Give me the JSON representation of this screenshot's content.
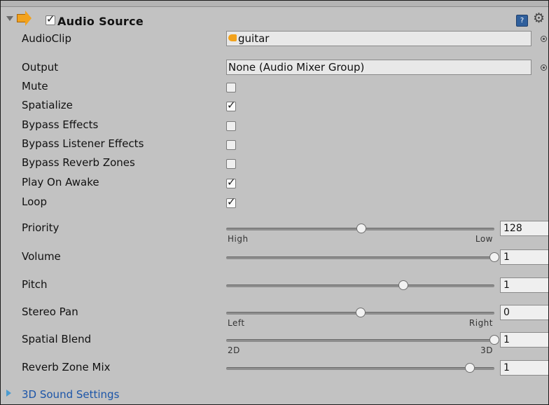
{
  "component": {
    "title": "Audio Source",
    "enabled": true,
    "help_icon": "help-book-icon",
    "settings_icon": "gear-icon"
  },
  "audio_clip": {
    "label": "AudioClip",
    "value": "guitar"
  },
  "output": {
    "label": "Output",
    "value": "None (Audio Mixer Group)"
  },
  "toggles": [
    {
      "label": "Mute",
      "checked": false
    },
    {
      "label": "Spatialize",
      "checked": true
    },
    {
      "label": "Bypass Effects",
      "checked": false
    },
    {
      "label": "Bypass Listener Effects",
      "checked": false
    },
    {
      "label": "Bypass Reverb Zones",
      "checked": false
    },
    {
      "label": "Play On Awake",
      "checked": true
    },
    {
      "label": "Loop",
      "checked": true
    }
  ],
  "sliders": [
    {
      "label": "Priority",
      "value": "128",
      "min_label": "High",
      "max_label": "Low",
      "fraction": 0.503
    },
    {
      "label": "Volume",
      "value": "1",
      "min_label": "",
      "max_label": "",
      "fraction": 1.0
    },
    {
      "label": "Pitch",
      "value": "1",
      "min_label": "",
      "max_label": "",
      "fraction": 0.661
    },
    {
      "label": "Stereo Pan",
      "value": "0",
      "min_label": "Left",
      "max_label": "Right",
      "fraction": 0.5
    },
    {
      "label": "Spatial Blend",
      "value": "1",
      "min_label": "2D",
      "max_label": "3D",
      "fraction": 1.0
    },
    {
      "label": "Reverb Zone Mix",
      "value": "1",
      "min_label": "",
      "max_label": "",
      "fraction": 0.909
    }
  ],
  "subsection": {
    "label": "3D Sound Settings"
  },
  "colors": {
    "panel": "#c2c2c2",
    "link": "#1c55a8",
    "accent": "#f2a21c"
  }
}
